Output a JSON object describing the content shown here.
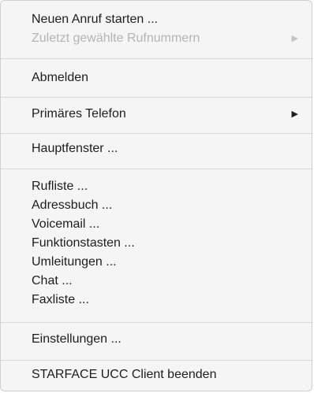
{
  "menu": {
    "new_call": "Neuen Anruf starten ...",
    "recent_numbers": "Zuletzt gewählte Rufnummern",
    "logout": "Abmelden",
    "primary_phone": "Primäres Telefon",
    "main_window": "Hauptfenster ...",
    "call_list": "Rufliste ...",
    "address_book": "Adressbuch ...",
    "voicemail": "Voicemail ...",
    "function_keys": "Funktionstasten ...",
    "redirects": "Umleitungen ...",
    "chat": "Chat ...",
    "fax_list": "Faxliste ...",
    "settings": "Einstellungen ...",
    "quit": "STARFACE UCC Client beenden"
  },
  "icons": {
    "submenu_arrow": "▶"
  },
  "colors": {
    "background": "#f5f5f5",
    "text": "#1d1d1d",
    "disabled_text": "#b5b5b5",
    "separator": "#d8d8d8"
  }
}
